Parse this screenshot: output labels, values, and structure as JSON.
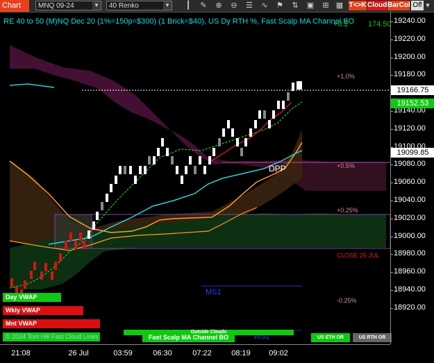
{
  "toolbar": {
    "chart_tab": "Chart",
    "instrument": "MNQ 09-24",
    "period": "40 Renko",
    "buttons": [
      "T<>K",
      "Cloud",
      "BarCol",
      "Off"
    ]
  },
  "chart": {
    "title": "RE 40 to 50 (M)NQ Dec 20 (1%=150p=$300) (1 Brick=$40), US Dy RTH %, Fast Scalp MA Channel BO",
    "title_suffix": "+0.2",
    "title_price": "174.50"
  },
  "price_axis": {
    "ticks": [
      "19240.00",
      "19220.00",
      "19200.00",
      "19180.00",
      "19160.00",
      "19140.00",
      "19120.00",
      "19100.00",
      "19080.00",
      "19060.00",
      "19040.00",
      "19020.00",
      "19000.00",
      "18980.00",
      "18960.00",
      "18940.00",
      "18920.00"
    ],
    "last_price": "19166.75",
    "green_price": "19152.53",
    "cyan_price": "19099.85"
  },
  "time_axis": [
    "21:08",
    "26 Jul",
    "03:59",
    "06:30",
    "07:22",
    "08:19",
    "09:02"
  ],
  "annotations": {
    "pct_plus1": "+1.0%",
    "pct_plus05": "+0.5%",
    "pct_plus025": "+0.25%",
    "close_label": "CLOSE 25 JUL",
    "pct_minus025": "-0.25%",
    "dpp": "DPP",
    "ms1": "MS1",
    "ws2": "WS2"
  },
  "panel_buttons": {
    "day_vwap": "Day VWAP",
    "wkly_vwap": "Wkly VWAP",
    "mnt_vwap": "Mnt VWAP",
    "bottom_left_text": "© 2024 Tom Hill Fast Cloud Lines",
    "fast_scalp": "Fast Scalp MA Channel BO",
    "outside_clouds": "Outside Clouds",
    "us_eth_or": "US ETH OR",
    "us_rth_or": "US RTH OR"
  },
  "colors": {
    "accent": "#e8401c",
    "up_brick": "#ffffff",
    "down_brick": "#888888",
    "red_brick": "#dd1111",
    "title": "#00e0e0",
    "price_green": "#11c811"
  }
}
